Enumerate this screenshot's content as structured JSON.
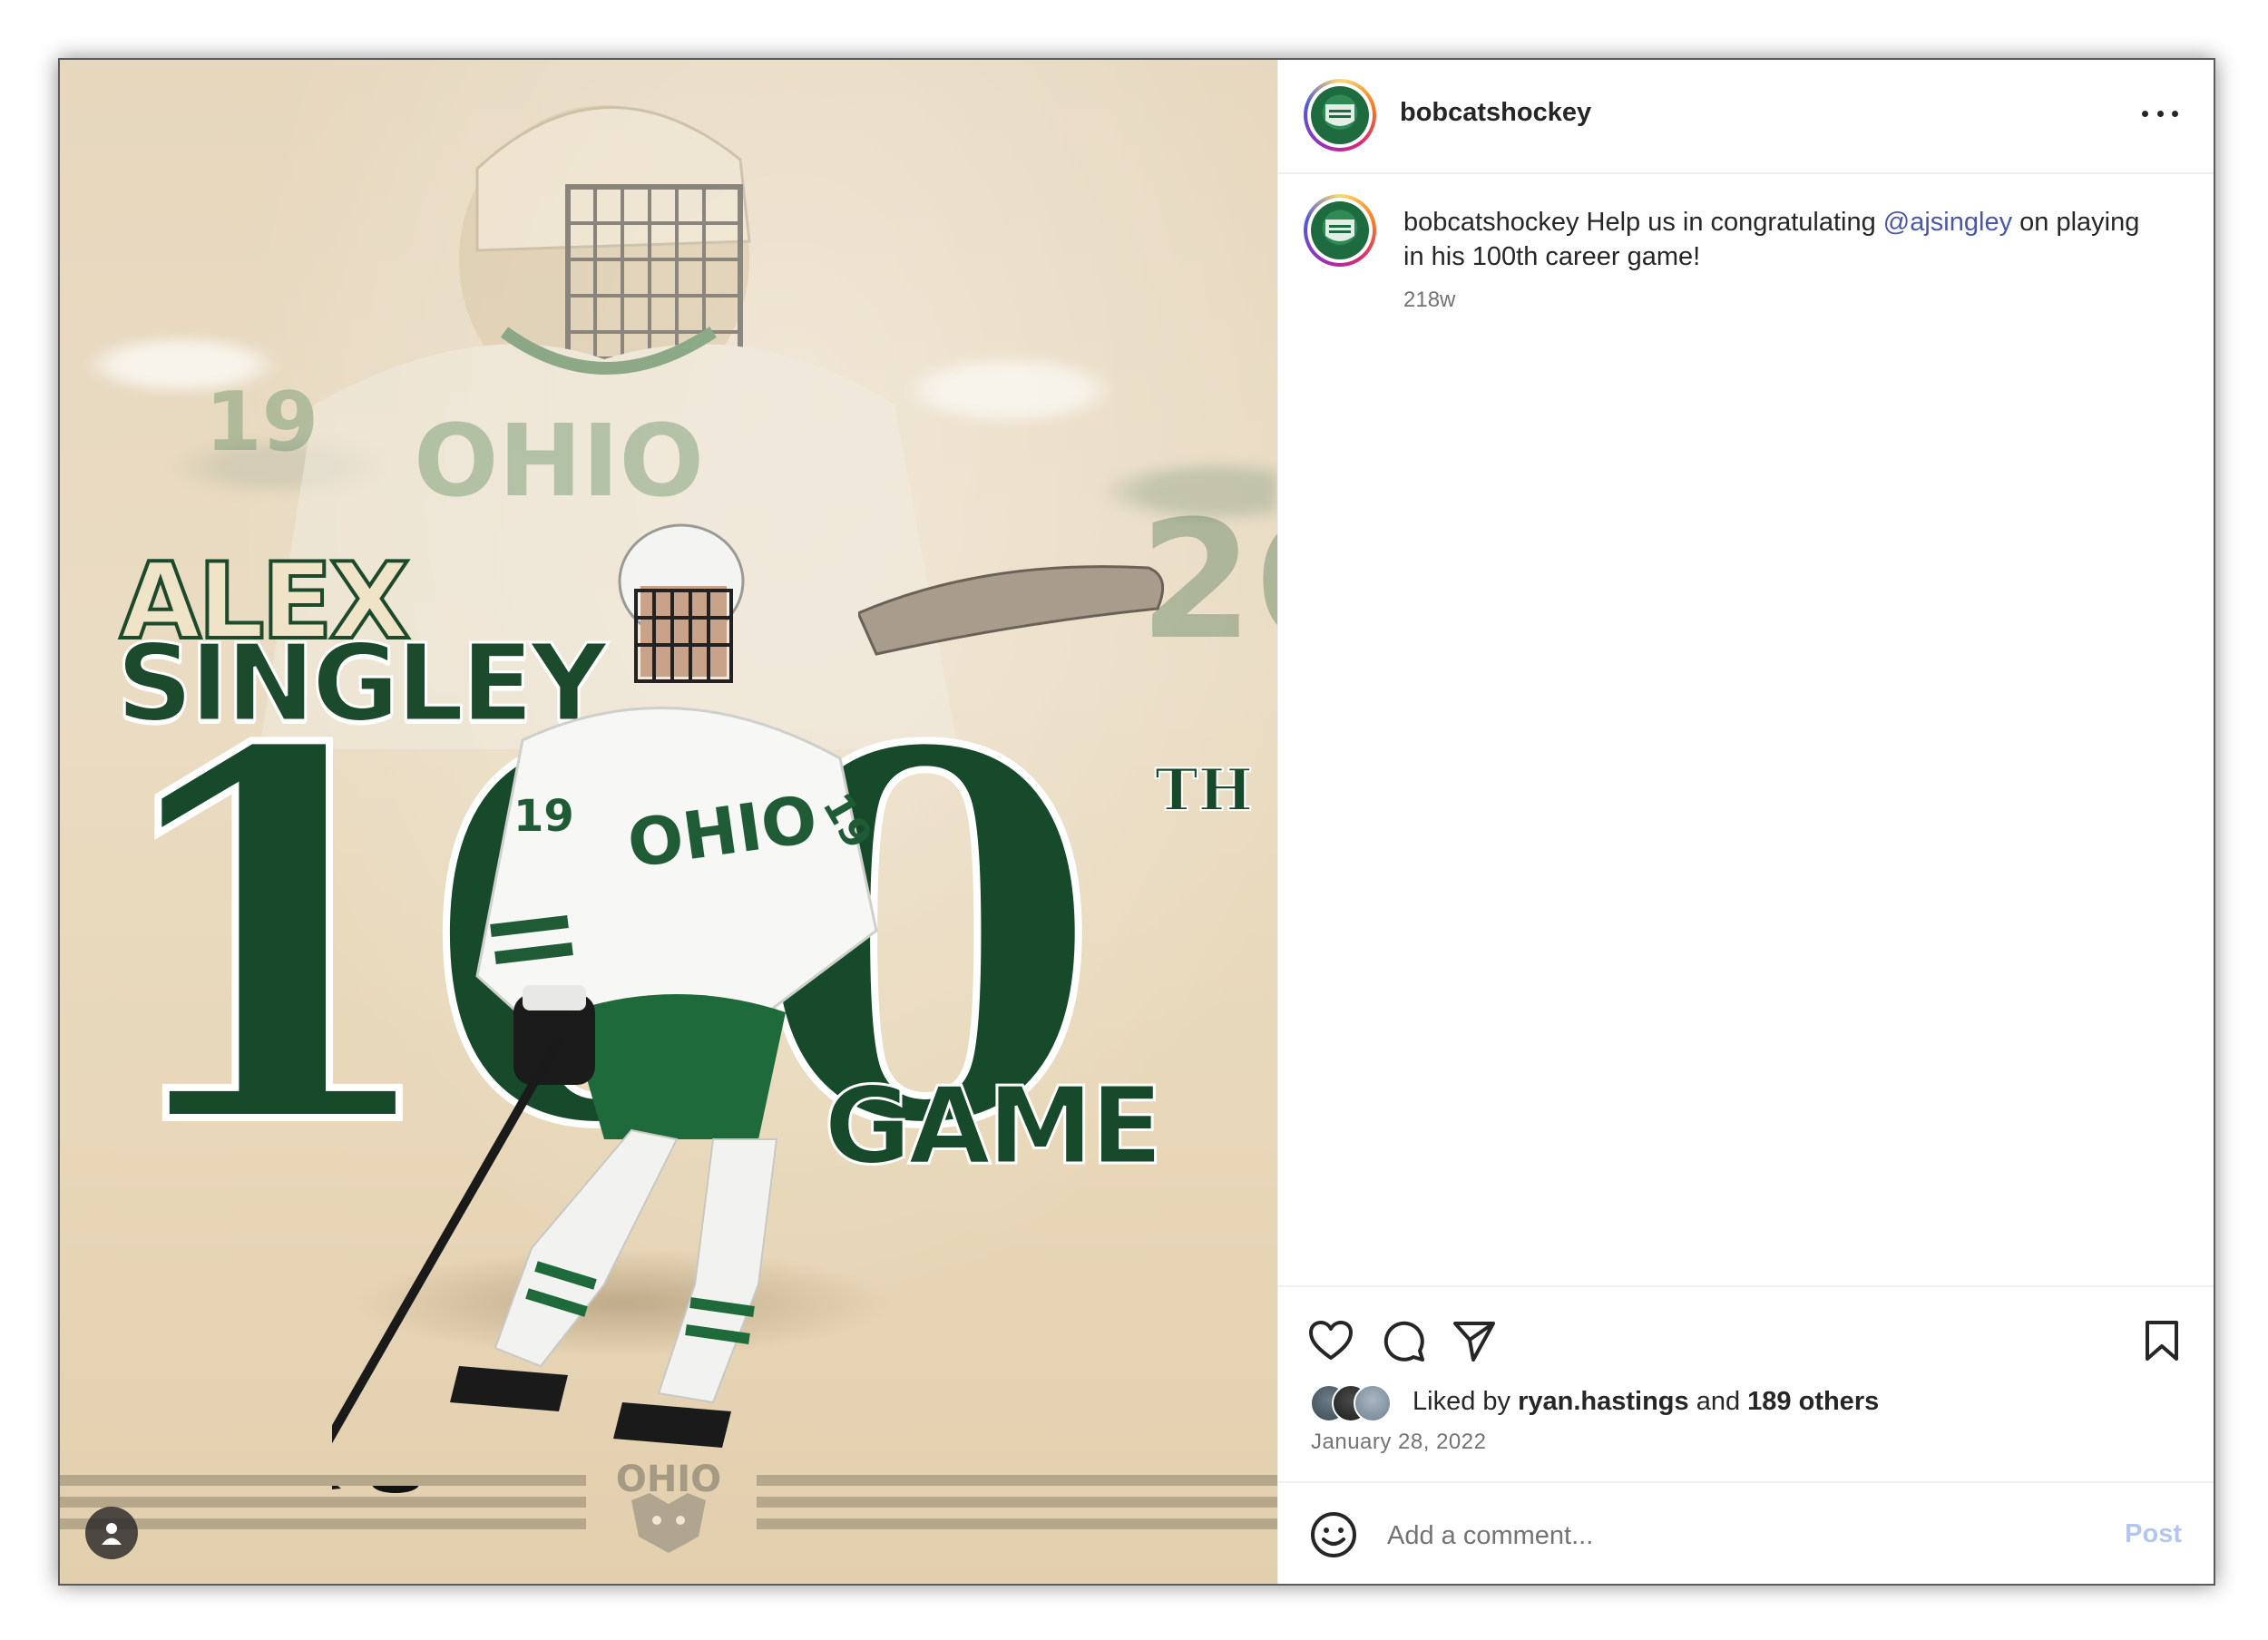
{
  "post": {
    "username": "bobcatshockey",
    "avatar_icon": "national-champions-badge",
    "more_icon": "more-horizontal-icon"
  },
  "poster": {
    "first_name": "ALEX",
    "last_name": "SINGLEY",
    "number": "100",
    "suffix": "TH",
    "word": "GAME",
    "logo_text": "OHIO",
    "colors": {
      "green": "#174a2b",
      "cream": "#e8d9bf",
      "stripe": "#b6a78b"
    }
  },
  "caption": {
    "username": "bobcatshockey",
    "text_before": "Help us in congratulating",
    "mention": "@ajsingley",
    "text_after": "on playing in his 100th career game!",
    "time_ago": "218w"
  },
  "actions": {
    "like_icon": "heart-icon",
    "comment_icon": "comment-icon",
    "share_icon": "share-icon",
    "save_icon": "bookmark-icon"
  },
  "likes": {
    "prefix": "Liked by",
    "user": "ryan.hastings",
    "joiner": "and",
    "others": "189 others"
  },
  "date": "January 28, 2022",
  "comment": {
    "placeholder": "Add a comment...",
    "post_label": "Post",
    "emoji_icon": "emoji-smile-icon"
  }
}
